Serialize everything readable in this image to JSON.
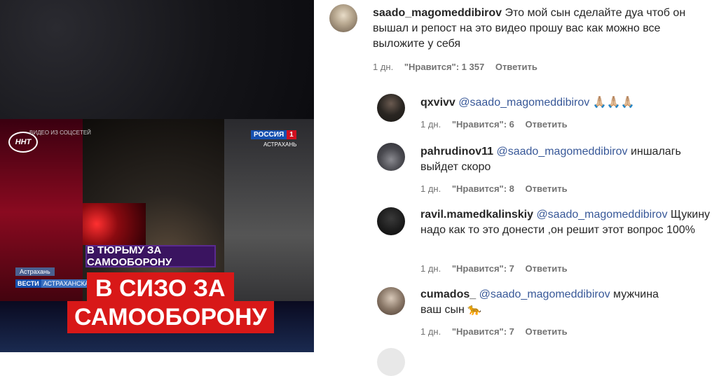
{
  "video": {
    "source_label": "ВИДЕО ИЗ СОЦСЕТЕЙ",
    "nnt_logo": "ННТ",
    "channel": "РОССИЯ",
    "channel_num": "1",
    "channel_city": "АСТРАХАНЬ",
    "city_tag": "Астрахань",
    "vesti": "ВЕСТИ",
    "vesti_region": "АСТРАХАНСКАЯ О",
    "caption_small": "В ТЮРЬМУ ЗА САМООБОРОНУ",
    "caption_big_line1": "В СИЗО ЗА",
    "caption_big_line2": "САМООБОРОНУ"
  },
  "main_comment": {
    "username": "saado_magomeddibirov",
    "text": "Это мой сын сделайте дуа чтоб он вышал и репост на это видео прошу вас как можно все выложите у себя",
    "time": "1 дн.",
    "likes": "\"Нравится\": 1 357",
    "reply": "Ответить"
  },
  "replies": [
    {
      "username": "qxvivv",
      "mention": "@saado_magomeddibirov",
      "text": " 🙏🏼🙏🏼🙏🏼",
      "time": "1 дн.",
      "likes": "\"Нравится\": 6",
      "reply": "Ответить"
    },
    {
      "username": "pahrudinov11",
      "mention": "@saado_magomeddibirov",
      "text": " иншалагь выйдет скоро",
      "time": "1 дн.",
      "likes": "\"Нравится\": 8",
      "reply": "Ответить"
    },
    {
      "username": "ravil.mamedkalinskiy",
      "mention": "@saado_magomeddibirov",
      "text": " Щукину надо как то это донести ,он решит этот вопрос 100%",
      "time": "1 дн.",
      "likes": "\"Нравится\": 7",
      "reply": "Ответить"
    },
    {
      "username": "cumados_",
      "mention": "@saado_magomeddibirov",
      "text": " мужчина ваш сын 🐆",
      "time": "1 дн.",
      "likes": "\"Нравится\": 7",
      "reply": "Ответить"
    }
  ]
}
